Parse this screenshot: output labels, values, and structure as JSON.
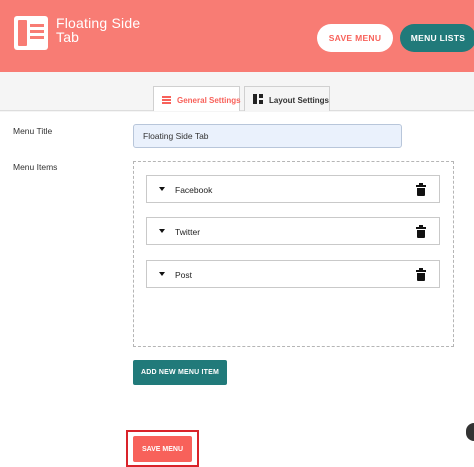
{
  "header": {
    "app_title": "Floating Side Tab",
    "save_menu_label": "SAVE MENU",
    "menu_lists_label": "MENU LISTS"
  },
  "tabs": [
    {
      "label": "General Settings",
      "icon": "menu-lines-icon",
      "active": true
    },
    {
      "label": "Layout Settings",
      "icon": "layout-grid-icon",
      "active": false
    }
  ],
  "form": {
    "menu_title_label": "Menu Title",
    "menu_title_value": "Floating Side Tab",
    "menu_items_label": "Menu Items",
    "items": [
      {
        "label": "Facebook"
      },
      {
        "label": "Twitter"
      },
      {
        "label": "Post"
      }
    ],
    "add_item_label": "ADD NEW MENU ITEM",
    "save_label": "SAVE MENU"
  },
  "colors": {
    "header_bg": "#f87c74",
    "accent_coral": "#f8615a",
    "teal": "#217a7a",
    "highlight_red": "#d9232a"
  }
}
